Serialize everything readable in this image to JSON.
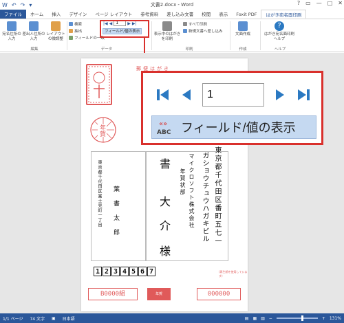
{
  "titlebar": {
    "title": "文書2.docx - Word",
    "quick_access": [
      "W",
      "↶",
      "↷",
      "▾"
    ],
    "window_controls": [
      "?",
      "▭",
      "—",
      "□",
      "✕"
    ]
  },
  "tabs": [
    "ファイル",
    "ホーム",
    "挿入",
    "デザイン",
    "ページ レイアウト",
    "参考資料",
    "差し込み文書",
    "校閲",
    "表示",
    "Foxit PDF",
    "はがき宛名面印刷"
  ],
  "active_tab": "はがき宛名面印刷",
  "ribbon": {
    "edit_group": {
      "label": "編集",
      "buttons": [
        "宛名住所の入力",
        "差出人住所の入力",
        "レイアウトの微調整"
      ]
    },
    "data_group": {
      "label": "データ",
      "search": "検索",
      "extract": "抽出",
      "field_match": "フィールドの一致",
      "record": "1",
      "field_display": "フィールド/値の表示"
    },
    "print_group": {
      "label": "印刷",
      "print_current": "表示中のはがきを印刷",
      "print_all": "すべて印刷",
      "merge_new": "新規文書へ差し込み"
    },
    "create_group": {
      "label": "作成",
      "doc_create": "文面作成"
    },
    "help_group": {
      "label": "ヘルプ",
      "help": "はがき宛名面印刷ヘルプ"
    }
  },
  "callout": {
    "record": "1",
    "field_display": "フィールド/値の表示"
  },
  "postcard": {
    "top_label": "郵便はがき",
    "recipient_address": "東京都千代田区富士見町一丁目",
    "recipient_company": "マイクロソフト株式会社",
    "recipient_dept": "年賀状部",
    "recipient_name_1": "書",
    "recipient_name_2": "大",
    "recipient_name_3": "介",
    "honorific": "様",
    "sender_address": "東京都千代田区番町五七一",
    "sender_company": "ガショウチュウハガキビル",
    "sender_name": "葉書太郎",
    "postal_code": [
      "1",
      "2",
      "3",
      "4",
      "5",
      "6",
      "7"
    ],
    "b_code": "B0000組",
    "right_code": "000000",
    "fine_print": "(再生紙を使用しています)",
    "stamp_text": "年賀"
  },
  "statusbar": {
    "page": "1/1 ページ",
    "words": "74 文字",
    "lang": "日本語",
    "zoom": "131%"
  },
  "colors": {
    "accent": "#2b579a",
    "highlight": "#d9302c",
    "postcard_red": "#e05a5a",
    "field_bg": "#c5d9f1"
  }
}
